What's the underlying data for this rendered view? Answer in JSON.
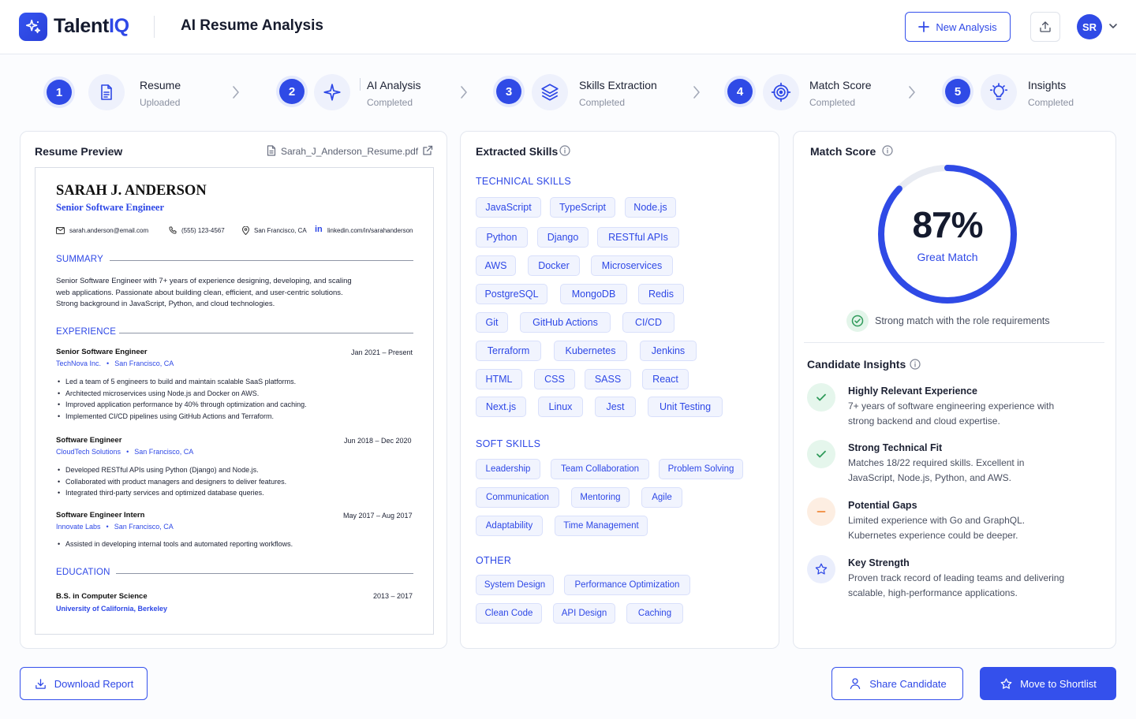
{
  "app": {
    "brand_prefix": "Talent",
    "brand_suffix": "IQ",
    "page_title": "AI Resume Analysis",
    "new_analysis_label": "New Analysis",
    "user_initials": "SR"
  },
  "steps": [
    {
      "number": "1",
      "title": "Resume",
      "status": "Uploaded",
      "icon": "document-icon"
    },
    {
      "number": "2",
      "title": "AI Analysis",
      "status": "Completed",
      "icon": "sparkle-icon"
    },
    {
      "number": "3",
      "title": "Skills Extraction",
      "status": "Completed",
      "icon": "layers-icon"
    },
    {
      "number": "4",
      "title": "Match Score",
      "status": "Completed",
      "icon": "target-icon"
    },
    {
      "number": "5",
      "title": "Insights",
      "status": "Completed",
      "icon": "lightbulb-icon"
    }
  ],
  "resume_preview": {
    "title": "Resume Preview",
    "file_name": "Sarah_J_Anderson_Resume.pdf",
    "name": "SARAH J. ANDERSON",
    "role": "Senior Software Engineer",
    "contact": {
      "email": "sarah.anderson@email.com",
      "phone": "(555) 123-4567",
      "location": "San Francisco, CA",
      "linkedin": "linkedin.com/in/sarahanderson"
    },
    "summary_heading": "SUMMARY",
    "summary": "Senior Software Engineer with 7+ years of experience designing, developing, and scaling web applications. Passionate about building clean, efficient, and user-centric solutions. Strong background in JavaScript, Python, and cloud technologies.",
    "experience_heading": "EXPERIENCE",
    "jobs": [
      {
        "title": "Senior Software Engineer",
        "company": "TechNova Inc.",
        "location": "San Francisco, CA",
        "dates": "Jan 2021 – Present",
        "bullets": [
          "Led a team of 5 engineers to build and maintain scalable SaaS platforms.",
          "Architected microservices using Node.js and Docker on AWS.",
          "Improved application performance by 40% through optimization and caching.",
          "Implemented CI/CD pipelines using GitHub Actions and Terraform."
        ]
      },
      {
        "title": "Software Engineer",
        "company": "CloudTech Solutions",
        "location": "San Francisco, CA",
        "dates": "Jun 2018 – Dec 2020",
        "bullets": [
          "Developed RESTful APIs using Python (Django) and Node.js.",
          "Collaborated with product managers and designers to deliver features.",
          "Integrated third-party services and optimized database queries."
        ]
      },
      {
        "title": "Software Engineer Intern",
        "company": "Innovate Labs",
        "location": "San Francisco, CA",
        "dates": "May 2017 – Aug 2017",
        "bullets": [
          "Assisted in developing internal tools and automated reporting workflows."
        ]
      }
    ],
    "education_heading": "EDUCATION",
    "education": {
      "degree": "B.S. in Computer Science",
      "school": "University of California, Berkeley",
      "dates": "2013 – 2017"
    }
  },
  "skills": {
    "title": "Extracted Skills",
    "technical_heading": "TECHNICAL SKILLS",
    "technical": [
      "JavaScript",
      "TypeScript",
      "Node.js",
      "Python",
      "Django",
      "RESTful APIs",
      "AWS",
      "Docker",
      "Microservices",
      "PostgreSQL",
      "MongoDB",
      "Redis",
      "Git",
      "GitHub Actions",
      "CI/CD",
      "Terraform",
      "Kubernetes",
      "Jenkins",
      "HTML",
      "CSS",
      "SASS",
      "React",
      "Next.js",
      "Linux",
      "Jest",
      "Unit Testing"
    ],
    "soft_heading": "SOFT SKILLS",
    "soft": [
      "Leadership",
      "Team Collaboration",
      "Problem Solving",
      "Communication",
      "Mentoring",
      "Agile",
      "Adaptability",
      "Time Management"
    ],
    "other_heading": "OTHER",
    "other": [
      "System Design",
      "Performance Optimization",
      "Clean Code",
      "API Design",
      "Caching"
    ]
  },
  "match": {
    "title": "Match Score",
    "score_text": "87%",
    "score_fraction": 0.87,
    "label": "Great Match",
    "note": "Strong match with the role requirements",
    "accent": "#2f4ae6",
    "track": "#e8ebf2"
  },
  "insights": {
    "title": "Candidate Insights",
    "items": [
      {
        "title": "Highly Relevant Experience",
        "desc": "7+ years of software engineering experience with strong backend and cloud expertise.",
        "icon": "check-icon"
      },
      {
        "title": "Strong Technical Fit",
        "desc": "Matches 18/22 required skills. Excellent in JavaScript, Node.js, Python, and AWS.",
        "icon": "check-icon"
      },
      {
        "title": "Potential Gaps",
        "desc": "Limited experience with Go and GraphQL. Kubernetes experience could be deeper.",
        "icon": "minus-icon"
      },
      {
        "title": "Key Strength",
        "desc": "Proven track record of leading teams and delivering scalable, high-performance applications.",
        "icon": "star-icon"
      }
    ]
  },
  "actions": {
    "download": "Download Report",
    "share": "Share Candidate",
    "shortlist": "Move to Shortlist"
  }
}
